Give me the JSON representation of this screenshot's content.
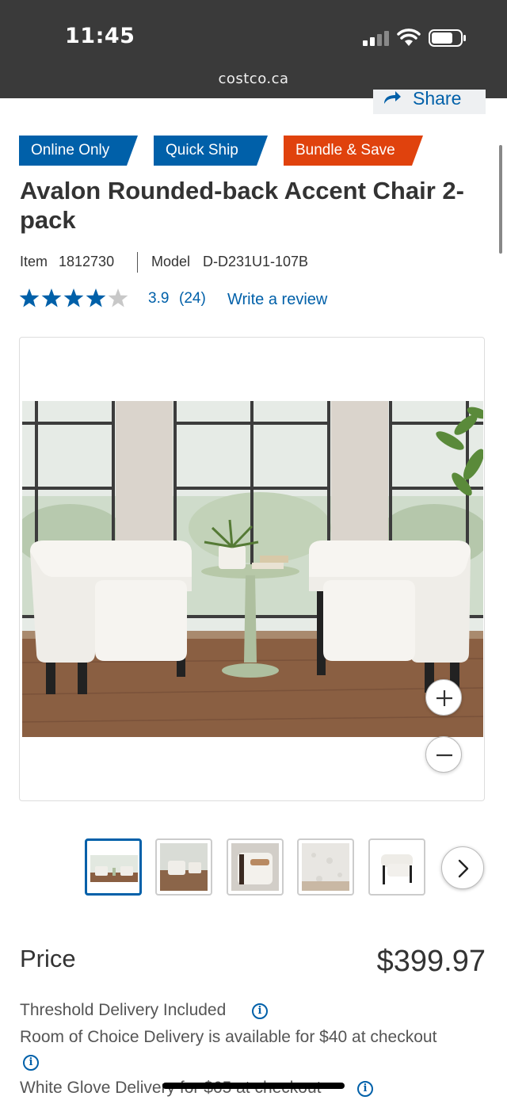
{
  "status_bar": {
    "time": "11:45",
    "url": "costco.ca"
  },
  "share": {
    "label": "Share"
  },
  "badges": [
    "Online Only",
    "Quick Ship",
    "Bundle & Save"
  ],
  "product": {
    "title": "Avalon Rounded-back Accent Chair 2-pack",
    "item_label": "Item",
    "item_number": "1812730",
    "model_label": "Model",
    "model_number": "D-D231U1-107B",
    "rating": "3.9",
    "stars": 3.9,
    "review_count": "(24)",
    "write_review": "Write a review"
  },
  "price": {
    "label": "Price",
    "value": "$399.97"
  },
  "delivery": [
    "Threshold Delivery Included",
    "Room of Choice Delivery is available for $40 at checkout",
    "White Glove Delivery for $65 at checkout"
  ],
  "colors": {
    "brand_blue": "#0060a9",
    "promo_orange": "#e0420d",
    "status_bar": "#3a3a3a"
  }
}
